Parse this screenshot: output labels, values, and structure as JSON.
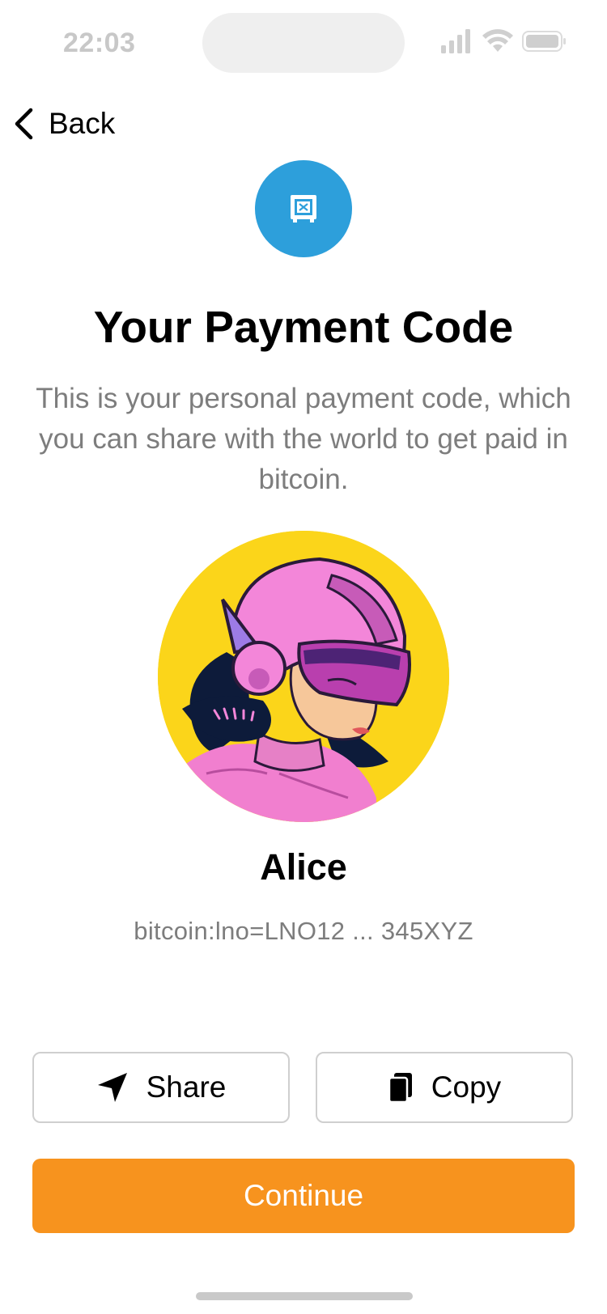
{
  "status_bar": {
    "time": "22:03",
    "icons": [
      "cellular-signal-icon",
      "wifi-icon",
      "battery-icon"
    ]
  },
  "nav": {
    "back_label": "Back",
    "back_icon": "chevron-left-icon"
  },
  "header": {
    "badge_icon": "safe-icon",
    "badge_color": "#2d9fdb",
    "title": "Your Payment Code",
    "subtitle": "This is your personal payment code, which you can share with the world to get paid in bitcoin."
  },
  "profile": {
    "avatar_background": "#fbd51a",
    "name": "Alice",
    "payment_code": "bitcoin:lno=LNO12 ... 345XYZ"
  },
  "actions": {
    "share_label": "Share",
    "share_icon": "send-icon",
    "copy_label": "Copy",
    "copy_icon": "copy-icon",
    "continue_label": "Continue",
    "continue_color": "#f7931e"
  }
}
